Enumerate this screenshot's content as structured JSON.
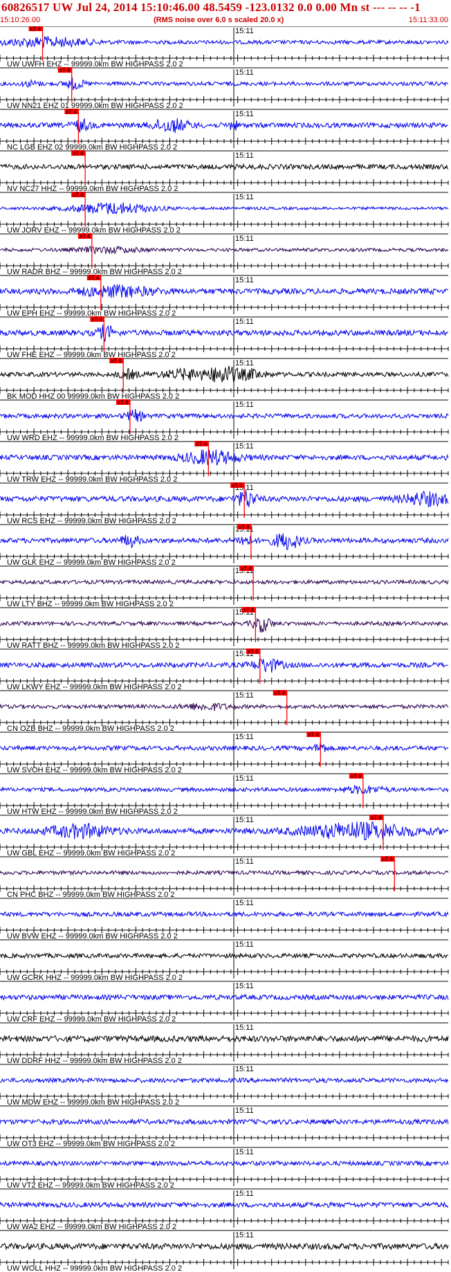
{
  "header": {
    "title": "60826517 UW Jul 24, 2014 15:10:46.00   48.5459 -123.0132  0.0 0.00 Mn st --- -- --   -1",
    "start_time": "15:10:26.00",
    "noise_note": "(RMS noise over 6.0 s scaled 20.0 x)",
    "end_time": "15:11:33.00"
  },
  "minute_label": "15:11",
  "pick_label": "xT 4",
  "colors": {
    "blue": "#0000ee",
    "black": "#000000",
    "purple": "#2a0050",
    "pick": "#ff0000",
    "title": "#cc0000"
  },
  "traces": [
    {
      "label": "UW UWFH EHZ -- 99999.0km BW  HIGHPASS  2.0  2",
      "color": "blue",
      "amp": 0.35,
      "pick": 0.095,
      "bursts": [
        [
          0.1,
          0.09,
          2.2
        ]
      ]
    },
    {
      "label": "UW NN21 EHZ 01 99999.0km BW  HIGHPASS  2.0  2",
      "color": "blue",
      "amp": 0.35,
      "pick": 0.16,
      "bursts": [
        [
          0.165,
          0.02,
          2.5
        ],
        [
          0.07,
          0.02,
          1.2
        ]
      ]
    },
    {
      "label": "NC LGB EHZ 02 99999.0km BW  HIGHPASS  2.0  2",
      "color": "blue",
      "amp": 0.45,
      "pick": 0.175,
      "bursts": [
        [
          0.18,
          0.02,
          2.0
        ],
        [
          0.38,
          0.04,
          2.3
        ],
        [
          0.52,
          0.01,
          1.8
        ]
      ]
    },
    {
      "label": "NV NC27 HHZ -- 99999.0km BW  HIGHPASS  2.0  2",
      "color": "black",
      "amp": 0.45,
      "pick": 0.19,
      "bursts": []
    },
    {
      "label": "UW JORV EHZ -- 99999.0km BW  HIGHPASS  2.0  2",
      "color": "blue",
      "amp": 0.25,
      "pick": 0.19,
      "bursts": [
        [
          0.25,
          0.09,
          3.8
        ]
      ]
    },
    {
      "label": "UW RADR BHZ -- 99999.0km BW  HIGHPASS  2.0  2",
      "color": "purple",
      "amp": 0.3,
      "pick": 0.205,
      "bursts": [
        [
          0.24,
          0.07,
          1.5
        ]
      ]
    },
    {
      "label": "UW EPH EHZ -- 99999.0km BW  HIGHPASS  2.0  2",
      "color": "blue",
      "amp": 0.5,
      "pick": 0.225,
      "bursts": [
        [
          0.26,
          0.08,
          1.6
        ]
      ]
    },
    {
      "label": "UW FHE EHZ -- 99999.0km BW  HIGHPASS  2.0  2",
      "color": "blue",
      "amp": 0.5,
      "pick": 0.232,
      "bursts": [
        [
          0.235,
          0.02,
          2.2
        ]
      ]
    },
    {
      "label": "BK MOD HHZ 00 99999.0km BW  HIGHPASS  2.0  2",
      "color": "black",
      "amp": 0.4,
      "pick": 0.275,
      "bursts": [
        [
          0.285,
          0.02,
          1.8
        ],
        [
          0.42,
          0.06,
          2.0
        ],
        [
          0.5,
          0.03,
          3.4
        ],
        [
          0.56,
          0.03,
          1.8
        ]
      ]
    },
    {
      "label": "UW WRD EHZ -- 99999.0km BW  HIGHPASS  2.0  2",
      "color": "blue",
      "amp": 0.4,
      "pick": 0.29,
      "bursts": [
        [
          0.3,
          0.02,
          2.2
        ]
      ]
    },
    {
      "label": "UW TRW EHZ -- 99999.0km BW  HIGHPASS  2.0  2",
      "color": "blue",
      "amp": 0.45,
      "pick": 0.465,
      "bursts": [
        [
          0.47,
          0.06,
          2.5
        ]
      ]
    },
    {
      "label": "UW RCS EHZ -- 99999.0km BW  HIGHPASS  2.0  2",
      "color": "blue",
      "amp": 0.5,
      "pick": 0.545,
      "bursts": [
        [
          0.55,
          0.02,
          2.8
        ],
        [
          0.95,
          0.05,
          2.0
        ]
      ]
    },
    {
      "label": "UW GLK EHZ -- 99999.0km BW  HIGHPASS  2.0  2",
      "color": "blue",
      "amp": 0.45,
      "pick": 0.56,
      "bursts": [
        [
          0.29,
          0.02,
          2.0
        ],
        [
          0.545,
          0.015,
          2.0
        ],
        [
          0.64,
          0.03,
          3.0
        ]
      ]
    },
    {
      "label": "UW LTY BHZ -- 99999.0km BW  HIGHPASS  2.0  2",
      "color": "purple",
      "amp": 0.35,
      "pick": 0.565,
      "bursts": []
    },
    {
      "label": "UW RATT BHZ -- 99999.0km BW  HIGHPASS  2.0  2",
      "color": "purple",
      "amp": 0.35,
      "pick": 0.57,
      "bursts": [
        [
          0.585,
          0.02,
          3.8
        ]
      ]
    },
    {
      "label": "UW LKWY EHZ -- 99999.0km BW  HIGHPASS  2.0  2",
      "color": "blue",
      "amp": 0.45,
      "pick": 0.58,
      "bursts": [
        [
          0.595,
          0.03,
          2.4
        ]
      ]
    },
    {
      "label": "CN OZB BHZ -- 99999.0km BW  HIGHPASS  2.0  2",
      "color": "purple",
      "amp": 0.35,
      "pick": 0.64,
      "bursts": [
        [
          0.46,
          0.05,
          1.4
        ]
      ]
    },
    {
      "label": "UW SVOH EHZ -- 99999.0km BW  HIGHPASS  2.0  2",
      "color": "blue",
      "amp": 0.4,
      "pick": 0.715,
      "bursts": [
        [
          0.715,
          0.01,
          3.0
        ]
      ]
    },
    {
      "label": "UW HTW EHZ -- 99999.0km BW  HIGHPASS  2.0  2",
      "color": "blue",
      "amp": 0.35,
      "pick": 0.81,
      "bursts": [
        [
          0.81,
          0.05,
          1.5
        ]
      ]
    },
    {
      "label": "UW GBL EHZ -- 99999.0km BW  HIGHPASS  2.0  2",
      "color": "blue",
      "amp": 0.5,
      "pick": 0.855,
      "bursts": [
        [
          0.18,
          0.07,
          2.0
        ],
        [
          0.8,
          0.12,
          2.6
        ]
      ]
    },
    {
      "label": "CN PHC BHZ -- 99999.0km BW  HIGHPASS  2.0  2",
      "color": "purple",
      "amp": 0.35,
      "pick": 0.88,
      "bursts": []
    },
    {
      "label": "UW BVW EHZ -- 99999.0km BW  HIGHPASS  2.0  2",
      "color": "blue",
      "amp": 0.4,
      "pick": null,
      "bursts": []
    },
    {
      "label": "UW GCRK HHZ -- 99999.0km BW  HIGHPASS  2.0  2",
      "color": "black",
      "amp": 0.4,
      "pick": null,
      "bursts": []
    },
    {
      "label": "UW CRF EHZ -- 99999.0km BW  HIGHPASS  2.0  2",
      "color": "blue",
      "amp": 0.45,
      "pick": null,
      "bursts": []
    },
    {
      "label": "UW DDRF HHZ -- 99999.0km BW  HIGHPASS  2.0  2",
      "color": "black",
      "amp": 0.55,
      "pick": null,
      "bursts": []
    },
    {
      "label": "UW MDW EHZ -- 99999.0km BW  HIGHPASS  2.0  2",
      "color": "blue",
      "amp": 0.4,
      "pick": null,
      "bursts": []
    },
    {
      "label": "UW OT3 EHZ -- 99999.0km BW  HIGHPASS  2.0  2",
      "color": "blue",
      "amp": 0.45,
      "pick": null,
      "bursts": []
    },
    {
      "label": "UW VT2 EHZ -- 99999.0km BW  HIGHPASS  2.0  2",
      "color": "blue",
      "amp": 0.4,
      "pick": null,
      "bursts": []
    },
    {
      "label": "UW WA2 EHZ -- 99999.0km BW  HIGHPASS  2.0  2",
      "color": "blue",
      "amp": 0.45,
      "pick": null,
      "bursts": []
    },
    {
      "label": "UW WOLL HHZ -- 99999.0km BW  HIGHPASS  2.0  2",
      "color": "black",
      "amp": 0.55,
      "pick": null,
      "bursts": []
    }
  ]
}
